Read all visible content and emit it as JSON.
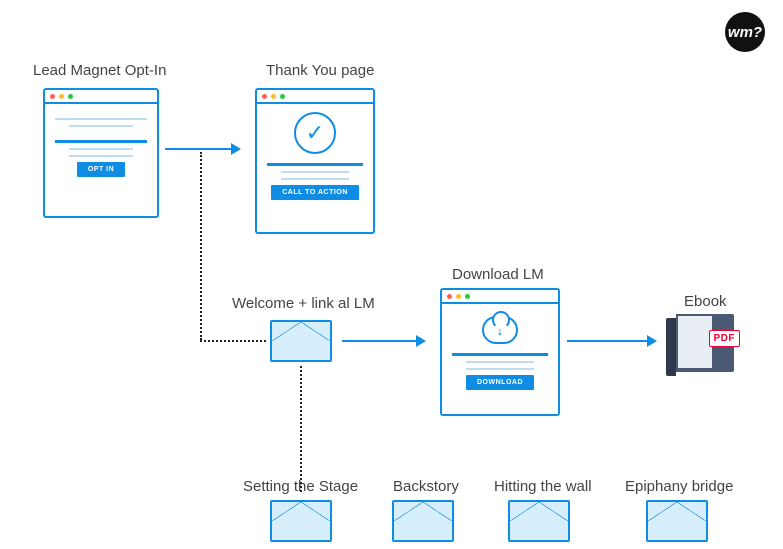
{
  "logo": "wm?",
  "nodes": {
    "optin": {
      "label": "Lead Magnet Opt-In",
      "button": "OPT IN"
    },
    "thankyou": {
      "label": "Thank You page",
      "button": "CALL TO ACTION"
    },
    "welcome": {
      "label": "Welcome + link al LM"
    },
    "download": {
      "label": "Download LM",
      "button": "DOWNLOAD"
    },
    "ebook": {
      "label": "Ebook",
      "tag": "PDF"
    }
  },
  "emails": {
    "e1": {
      "label": "Setting the Stage"
    },
    "e2": {
      "label": "Backstory"
    },
    "e3": {
      "label": "Hitting the wall"
    },
    "e4": {
      "label": "Epiphany bridge"
    }
  }
}
